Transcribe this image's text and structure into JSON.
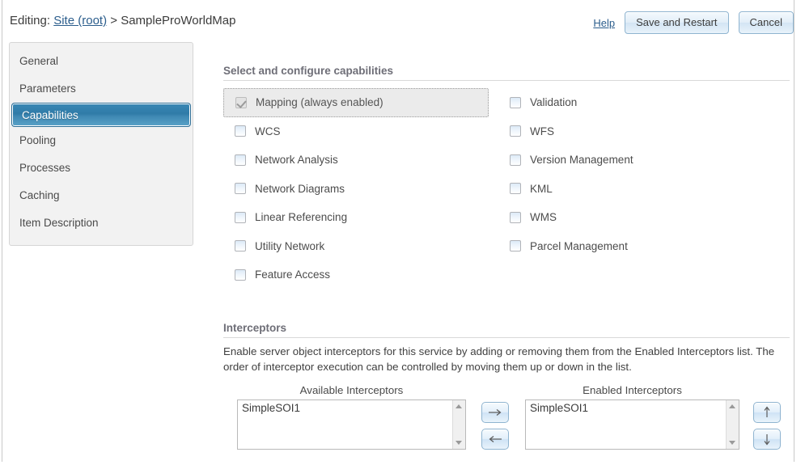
{
  "header": {
    "editing_label": "Editing:",
    "site_link": "Site (root)",
    "separator": ">",
    "service_name": "SampleProWorldMap",
    "help_label": "Help",
    "save_label": "Save and Restart",
    "cancel_label": "Cancel"
  },
  "sidebar": {
    "items": [
      {
        "label": "General",
        "selected": false
      },
      {
        "label": "Parameters",
        "selected": false
      },
      {
        "label": "Capabilities",
        "selected": true
      },
      {
        "label": "Pooling",
        "selected": false
      },
      {
        "label": "Processes",
        "selected": false
      },
      {
        "label": "Caching",
        "selected": false
      },
      {
        "label": "Item Description",
        "selected": false
      }
    ]
  },
  "capabilities": {
    "title": "Select and configure capabilities",
    "left_column": [
      {
        "label": "Mapping (always enabled)",
        "checked": true,
        "disabled": true,
        "focused": true
      },
      {
        "label": "WCS",
        "checked": false,
        "disabled": false,
        "focused": false
      },
      {
        "label": "Network Analysis",
        "checked": false,
        "disabled": false,
        "focused": false
      },
      {
        "label": "Network Diagrams",
        "checked": false,
        "disabled": false,
        "focused": false
      },
      {
        "label": "Linear Referencing",
        "checked": false,
        "disabled": false,
        "focused": false
      },
      {
        "label": "Utility Network",
        "checked": false,
        "disabled": false,
        "focused": false
      },
      {
        "label": "Feature Access",
        "checked": false,
        "disabled": false,
        "focused": false
      }
    ],
    "right_column": [
      {
        "label": "Validation",
        "checked": false,
        "disabled": false,
        "focused": false
      },
      {
        "label": "WFS",
        "checked": false,
        "disabled": false,
        "focused": false
      },
      {
        "label": "Version Management",
        "checked": false,
        "disabled": false,
        "focused": false
      },
      {
        "label": "KML",
        "checked": false,
        "disabled": false,
        "focused": false
      },
      {
        "label": "WMS",
        "checked": false,
        "disabled": false,
        "focused": false
      },
      {
        "label": "Parcel Management",
        "checked": false,
        "disabled": false,
        "focused": false
      }
    ]
  },
  "interceptors": {
    "title": "Interceptors",
    "description": "Enable server object interceptors for this service by adding or removing them from the Enabled Interceptors list. The order of interceptor execution can be controlled by moving them up or down in the list.",
    "available_caption": "Available Interceptors",
    "available_items": [
      "SimpleSOI1"
    ],
    "enabled_caption": "Enabled Interceptors",
    "enabled_items": [
      "SimpleSOI1"
    ],
    "buttons": {
      "add": "→",
      "remove": "←",
      "move_up": "↑",
      "move_down": "↓"
    }
  },
  "colors": {
    "accent_selected": "#2f7ba8",
    "link": "#2b5d8c",
    "button_border": "#8fb4d0",
    "section_heading": "#6e6e77",
    "panel_bg": "#f2f2f2"
  }
}
